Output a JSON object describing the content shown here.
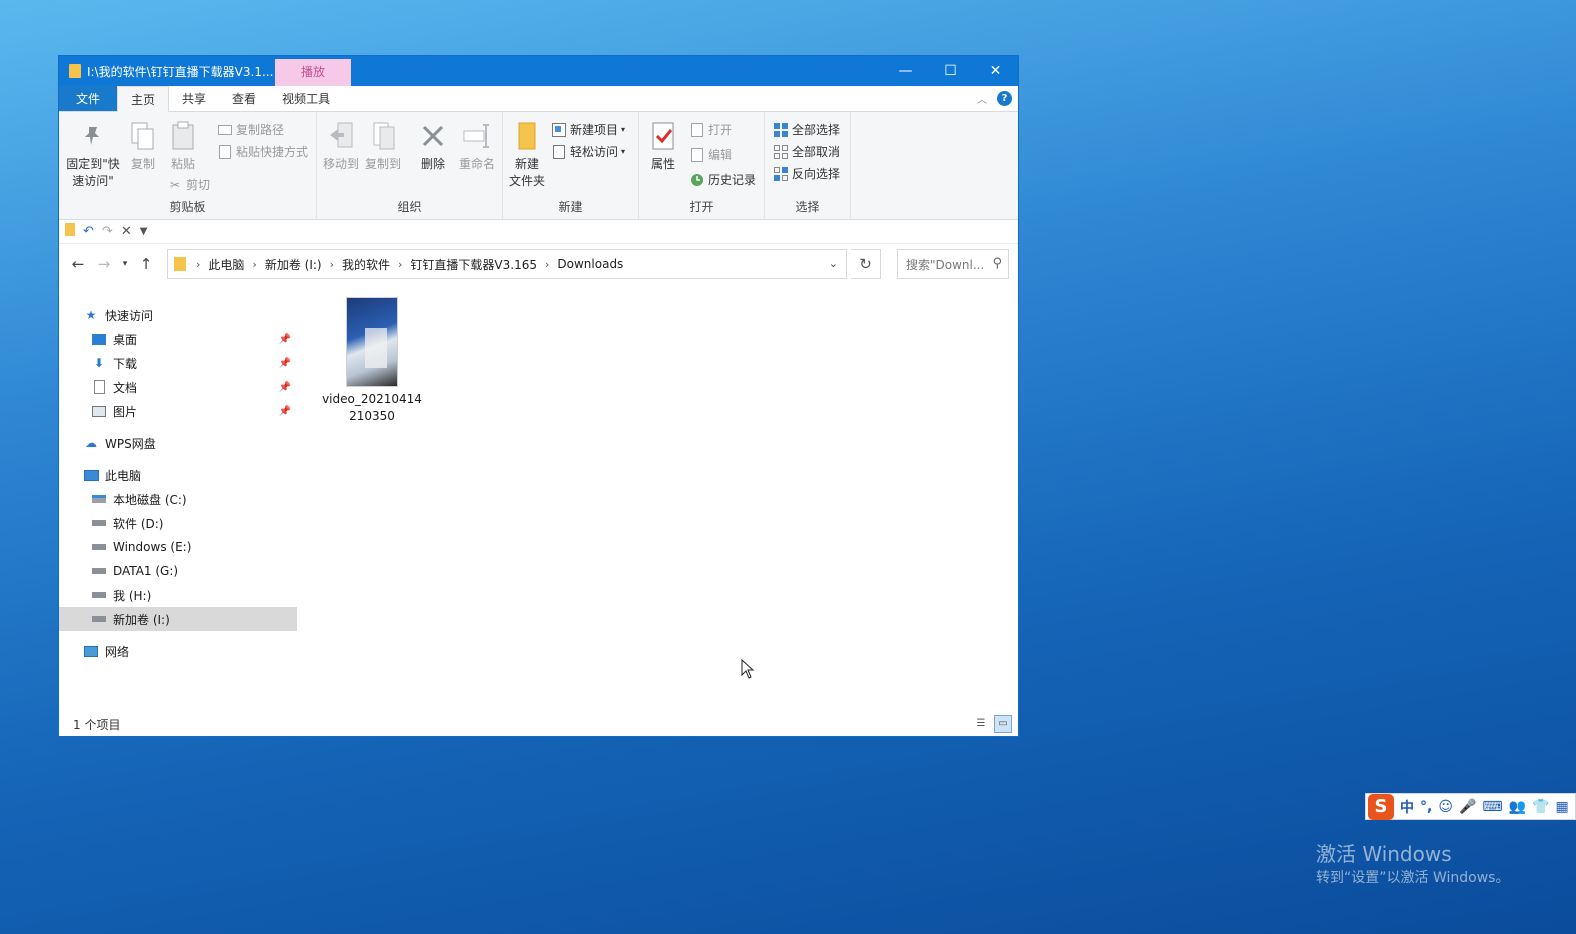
{
  "desktop": {
    "watermark_line1": "激活 Windows",
    "watermark_line2": "转到“设置”以激活 Windows。"
  },
  "ime": {
    "logo": "S",
    "items": [
      "中",
      "°,",
      "☺",
      "🎤",
      "⌨",
      "👥",
      "👕",
      "▦"
    ]
  },
  "window": {
    "title": "I:\\我的软件\\钉钉直播下载器V3.1...",
    "context_tab": "播放",
    "controls": {
      "minimize": "—",
      "maximize": "☐",
      "close": "✕"
    }
  },
  "ribbon_tabs": {
    "file": "文件",
    "home": "主页",
    "share": "共享",
    "view": "查看",
    "video_tools": "视频工具"
  },
  "ribbon": {
    "clipboard": {
      "label": "剪贴板",
      "pin": "固定到\"快\n速访问\"",
      "copy": "复制",
      "paste": "粘贴",
      "copy_path": "复制路径",
      "paste_shortcut": "粘贴快捷方式",
      "cut": "剪切"
    },
    "organize": {
      "label": "组织",
      "move_to": "移动到",
      "copy_to": "复制到",
      "delete": "删除",
      "rename": "重命名"
    },
    "new": {
      "label": "新建",
      "new_folder": "新建\n文件夹",
      "new_item": "新建项目",
      "easy_access": "轻松访问"
    },
    "open": {
      "label": "打开",
      "properties": "属性",
      "open": "打开",
      "edit": "编辑",
      "history": "历史记录"
    },
    "select": {
      "label": "选择",
      "select_all": "全部选择",
      "select_none": "全部取消",
      "invert": "反向选择"
    }
  },
  "address": {
    "crumbs": [
      "此电脑",
      "新加卷 (I:)",
      "我的软件",
      "钉钉直播下载器V3.165",
      "Downloads"
    ],
    "search_placeholder": "搜索\"Downl..."
  },
  "navpane": {
    "quick_access": "快速访问",
    "desktop": "桌面",
    "downloads": "下载",
    "documents": "文档",
    "pictures": "图片",
    "wps": "WPS网盘",
    "this_pc": "此电脑",
    "drive_c": "本地磁盘 (C:)",
    "drive_d": "软件 (D:)",
    "drive_e": "Windows (E:)",
    "drive_g": "DATA1 (G:)",
    "drive_h": "我 (H:)",
    "drive_i": "新加卷 (I:)",
    "network": "网络"
  },
  "files": [
    {
      "name": "video_20210414210350"
    }
  ],
  "status": {
    "count": "1 个项目"
  }
}
